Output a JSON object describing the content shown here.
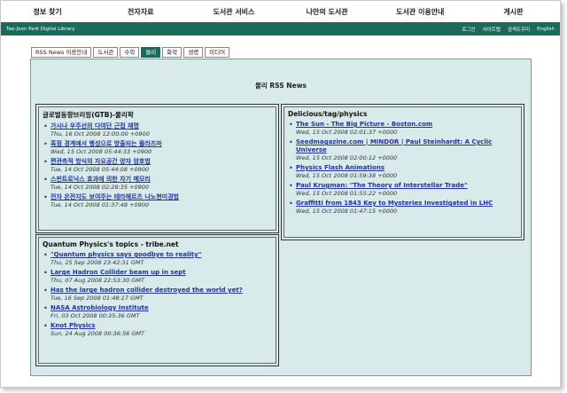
{
  "topnav": {
    "items": [
      "정보 찾기",
      "전자자료",
      "도서관 서비스",
      "나만의 도서관",
      "도서관 이용안내",
      "게시판"
    ]
  },
  "greenbar": {
    "library_name": "Tae-Joon Park Digital Library",
    "links": [
      "로그인",
      "사이트맵",
      "검색도우미",
      "English"
    ]
  },
  "tabs": [
    {
      "label": "RSS News 이용안내",
      "active": false
    },
    {
      "label": "도서관",
      "active": false
    },
    {
      "label": "수학",
      "active": false
    },
    {
      "label": "물리",
      "active": true
    },
    {
      "label": "화학",
      "active": false
    },
    {
      "label": "생명",
      "active": false
    },
    {
      "label": "미디어",
      "active": false
    }
  ],
  "page_title": "물리 RSS News",
  "panels": {
    "gtb": {
      "title": "글로벌동향브리핑(GTB)-물리학",
      "items": [
        {
          "title": "가시나 우주선의 다여단 근접 재명",
          "date": "Thu, 16 Oct 2008 12:00:00 +0900"
        },
        {
          "title": "흑점 경계에서 행성으로 방출되는 플라즈마",
          "date": "Wed, 15 Oct 2008 05:44:33 +0900"
        },
        {
          "title": "편관측적 방식의 자요공간 양자 암호법",
          "date": "Tue, 14 Oct 2008 05:44:08 +0900"
        },
        {
          "title": "스핀트로닉스 효과에 의한 자기 메모리",
          "date": "Tue, 14 Oct 2008 02:28:35 +0900"
        },
        {
          "title": "전자 온전지도 보여주는 테라헤르츠 나노현미경법",
          "date": "Tue, 14 Oct 2008 01:37:48 +0900"
        }
      ]
    },
    "quantum": {
      "title": "Quantum Physics's topics - tribe.net",
      "items": [
        {
          "title": "\"Quantum physics says goodbye to reality\"",
          "date": "Thu, 25 Sep 2008 23:42:31 GMT"
        },
        {
          "title": "Large Hadron Collider beam up in sept",
          "date": "Thu, 07 Aug 2008 22:53:30 GMT"
        },
        {
          "title": "Has the large hadron collider destroyed the world yet?",
          "date": "Tue, 16 Sep 2008 01:48:17 GMT"
        },
        {
          "title": "NASA Astrobiology Institute",
          "date": "Fri, 03 Oct 2008 00:35:36 GMT"
        },
        {
          "title": "Knot Physics",
          "date": "Sun, 24 Aug 2008 00:36:56 GMT"
        }
      ]
    },
    "delicious": {
      "title": "Delicious/tag/physics",
      "items": [
        {
          "title": "The Sun - The Big Picture - Boston.com",
          "date": "Wed, 15 Oct 2008 02:01:37 +0000"
        },
        {
          "title": "Seedmagazine.com | MINDOR | Paul Steinhardt: A Cyclic Universe",
          "date": "Wed, 15 Oct 2008 02:00:12 +0000"
        },
        {
          "title": "Physics Flash Animations",
          "date": "Wed, 15 Oct 2008 01:59:38 +0000"
        },
        {
          "title": "Paul Krugman: \"The Theory of Interstellar Trade\"",
          "date": "Wed, 15 Oct 2008 01:55:22 +0000"
        },
        {
          "title": "Graffitti from 1843 Key to Mysteries Investigated in LHC",
          "date": "Wed, 15 Oct 2008 01:47:15 +0000"
        }
      ]
    }
  }
}
